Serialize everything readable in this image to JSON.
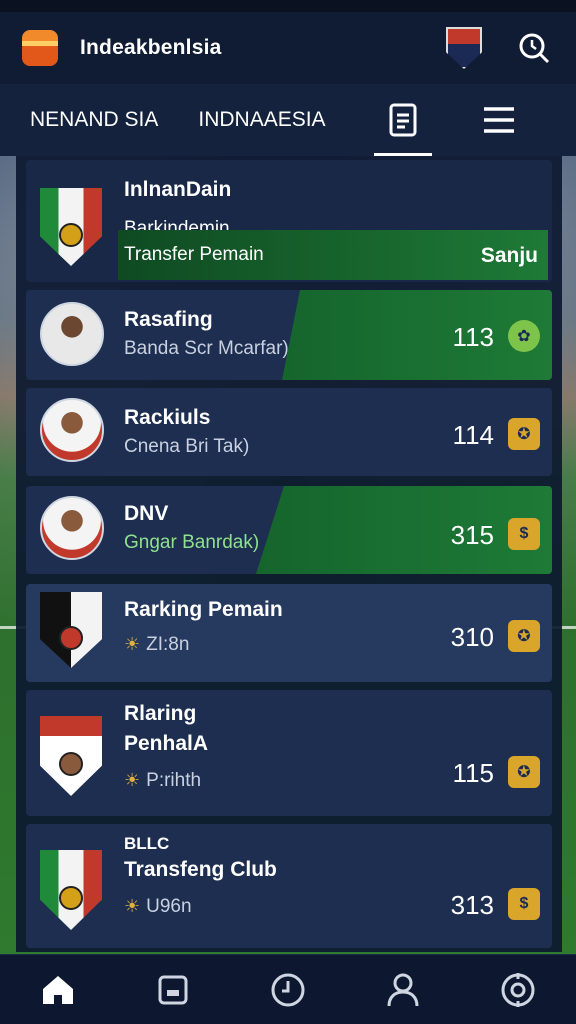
{
  "app": {
    "title": "Indeakbenlsia"
  },
  "tabs": [
    {
      "label": "NENAND SIA"
    },
    {
      "label": "INDNAAESIA"
    }
  ],
  "header_card": {
    "title": "InlnanDain",
    "line1": "Barkindemin",
    "line2": "Transfer Pemain",
    "action": "Sanju"
  },
  "rows": [
    {
      "name": "Rasafing",
      "sub": "Banda Scr Mcarfar)",
      "value": "113"
    },
    {
      "name": "Rackiuls",
      "sub": "Cnena Bri Tak)",
      "value": "114"
    },
    {
      "name": "DNV",
      "sub": "Gngar Banrdak)",
      "value": "315"
    },
    {
      "name": "Rarking Pemain",
      "sub": "ZI:8n",
      "value": "310"
    },
    {
      "name": "Rlaring",
      "name2": "PenhalA",
      "sub": "P:rihth",
      "value": "115"
    },
    {
      "name": "BLLC",
      "name2": "Transfeng Club",
      "sub": "U96n",
      "value": "313"
    }
  ],
  "colors": {
    "accent_green": "#1e7a36",
    "badge_gold": "#d9a62b",
    "background": "#0d1830"
  }
}
